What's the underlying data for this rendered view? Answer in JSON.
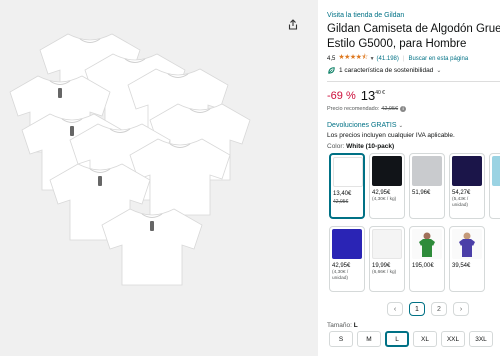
{
  "store_link": "Visita la tienda de Gildan",
  "title": "Gildan Camiseta de Algodón Grueso, Estilo G5000, para Hombre",
  "rating": {
    "value": "4,5",
    "stars": "★★★★⯪",
    "count": "(41.198)",
    "search_link": "Buscar en esta página"
  },
  "sustainability": "1 característica de sostenibilidad",
  "price": {
    "discount": "-69 %",
    "integer": "13",
    "decimal": "40 €",
    "rrp_label": "Precio recomendado:",
    "rrp_value": "42,95€"
  },
  "returns_label": "Devoluciones GRATIS",
  "vat_note": "Los precios incluyen cualquier IVA aplicable.",
  "color": {
    "label": "Color:",
    "selected": "White (10-pack)"
  },
  "swatches": [
    {
      "name": "white",
      "color": "#ffffff",
      "price": "13,40€",
      "old": "42,95€",
      "unit": ""
    },
    {
      "name": "black",
      "color": "#111418",
      "price": "42,95€",
      "old": "",
      "unit": "(4,30€ / kg)"
    },
    {
      "name": "sport-grey",
      "color": "#c9cbce",
      "price": "51,96€",
      "old": "",
      "unit": ""
    },
    {
      "name": "navy",
      "color": "#1b1549",
      "price": "54,27€",
      "old": "",
      "unit": "(5,43€ /\nunidad)"
    },
    {
      "name": "light-blue",
      "color": "#9bd3e3",
      "price": "",
      "old": "",
      "unit": ""
    },
    {
      "name": "royal-blue",
      "color": "#2a24b5",
      "price": "42,95€",
      "old": "",
      "unit": "(4,30€ /\nunidad)"
    },
    {
      "name": "white-pack",
      "color": "#f4f4f4",
      "price": "19,99€",
      "old": "",
      "unit": "(6,66€ / kg)"
    },
    {
      "name": "green-model",
      "color": "#2e8b3a",
      "price": "195,00€",
      "old": "",
      "unit": ""
    },
    {
      "name": "purple-model",
      "color": "#4b3fa8",
      "price": "39,54€",
      "old": "",
      "unit": ""
    }
  ],
  "pager": {
    "prev": "‹",
    "page1": "1",
    "page2": "2",
    "next": "›"
  },
  "size": {
    "label": "Tamaño:",
    "selected": "L",
    "options": [
      "S",
      "M",
      "L",
      "XL",
      "XXL",
      "3XL",
      "4XL",
      "5XL"
    ]
  },
  "colors": {
    "link": "#007185",
    "discount": "#cc0c39",
    "star": "#de7921",
    "selected_border": "#007185"
  }
}
